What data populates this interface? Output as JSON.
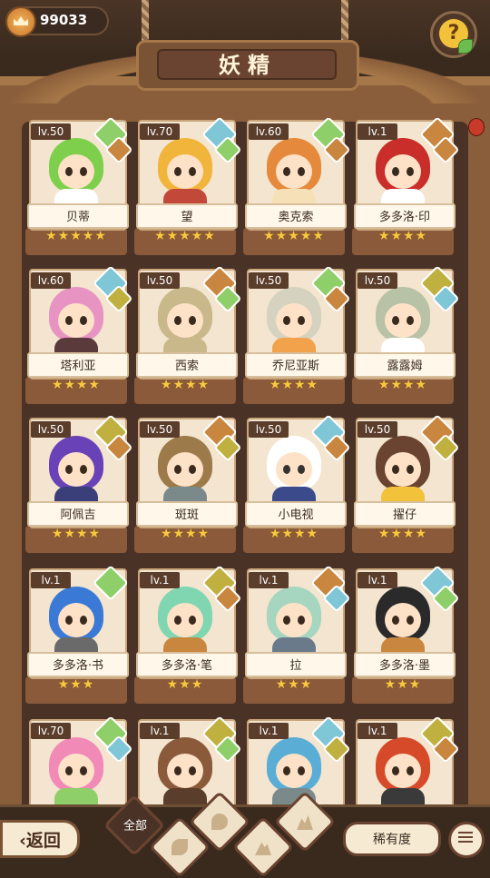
{
  "currency": {
    "amount": "99033",
    "icon": "crown-coin-icon"
  },
  "title": "妖精",
  "help_icon": "question-mark-icon",
  "cards": [
    {
      "level": "lv.50",
      "name": "贝蒂",
      "stars": "★★★★★",
      "hair": "#7ecf4c",
      "outfit": "#fff",
      "gem1": "#8fcf6a",
      "gem2": "#c9863f"
    },
    {
      "level": "lv.70",
      "name": "望",
      "stars": "★★★★★",
      "hair": "#f2b53c",
      "outfit": "#c2483a",
      "gem1": "#7fc6d6",
      "gem2": "#8fcf6a"
    },
    {
      "level": "lv.60",
      "name": "奥克索",
      "stars": "★★★★★",
      "hair": "#e58a3c",
      "outfit": "#f5e0b8",
      "gem1": "#8fcf6a",
      "gem2": "#c9863f"
    },
    {
      "level": "lv.1",
      "name": "多多洛·印",
      "stars": "★★★★",
      "hair": "#c92e2a",
      "outfit": "#fff",
      "gem1": "#c9863f",
      "gem2": "#c9863f"
    },
    {
      "level": "lv.60",
      "name": "塔利亚",
      "stars": "★★★★",
      "hair": "#e894c3",
      "outfit": "#5a3a3a",
      "gem1": "#7fc6d6",
      "gem2": "#c0b040"
    },
    {
      "level": "lv.50",
      "name": "西索",
      "stars": "★★★★",
      "hair": "#c9b98a",
      "outfit": "#c9b98a",
      "gem1": "#c9863f",
      "gem2": "#8fcf6a"
    },
    {
      "level": "lv.50",
      "name": "乔尼亚斯",
      "stars": "★★★★",
      "hair": "#d6d2c0",
      "outfit": "#f2a24a",
      "gem1": "#8fcf6a",
      "gem2": "#c9863f"
    },
    {
      "level": "lv.50",
      "name": "露露姆",
      "stars": "★★★★",
      "hair": "#b8c2a6",
      "outfit": "#fff",
      "gem1": "#c0b040",
      "gem2": "#7fc6d6"
    },
    {
      "level": "lv.50",
      "name": "阿佩吉",
      "stars": "★★★★",
      "hair": "#6a42b8",
      "outfit": "#3a3f7a",
      "gem1": "#c0b040",
      "gem2": "#c9863f"
    },
    {
      "level": "lv.50",
      "name": "斑斑",
      "stars": "★★★★",
      "hair": "#9c7a4a",
      "outfit": "#7a8a8a",
      "gem1": "#c9863f",
      "gem2": "#c0b040"
    },
    {
      "level": "lv.50",
      "name": "小电视",
      "stars": "★★★★",
      "hair": "#fff",
      "outfit": "#3a4a8a",
      "gem1": "#7fc6d6",
      "gem2": "#c9863f"
    },
    {
      "level": "lv.50",
      "name": "擢仔",
      "stars": "★★★★",
      "hair": "#6a4430",
      "outfit": "#f2c23b",
      "gem1": "#c9863f",
      "gem2": "#c0b040"
    },
    {
      "level": "lv.1",
      "name": "多多洛·书",
      "stars": "★★★",
      "hair": "#3a7ad6",
      "outfit": "#6a6a6a",
      "gem1": "#8fcf6a",
      "gem2": ""
    },
    {
      "level": "lv.1",
      "name": "多多洛·笔",
      "stars": "★★★",
      "hair": "#7fd6b0",
      "outfit": "#c9863f",
      "gem1": "#c0b040",
      "gem2": "#c9863f"
    },
    {
      "level": "lv.1",
      "name": "拉",
      "stars": "★★★",
      "hair": "#a6d6c0",
      "outfit": "#6a7a8a",
      "gem1": "#c9863f",
      "gem2": "#7fc6d6"
    },
    {
      "level": "lv.1",
      "name": "多多洛·墨",
      "stars": "★★★",
      "hair": "#2a2a2a",
      "outfit": "#c9863f",
      "gem1": "#7fc6d6",
      "gem2": "#8fcf6a"
    },
    {
      "level": "lv.70",
      "name": "",
      "stars": "",
      "hair": "#f28ab8",
      "outfit": "#8fcf6a",
      "gem1": "#8fcf6a",
      "gem2": "#7fc6d6"
    },
    {
      "level": "lv.1",
      "name": "",
      "stars": "",
      "hair": "#8a5a3a",
      "outfit": "#5a3d2b",
      "gem1": "#c0b040",
      "gem2": "#8fcf6a"
    },
    {
      "level": "lv.1",
      "name": "",
      "stars": "",
      "hair": "#5aaed6",
      "outfit": "#7a8a8a",
      "gem1": "#7fc6d6",
      "gem2": "#c0b040"
    },
    {
      "level": "lv.1",
      "name": "",
      "stars": "",
      "hair": "#d64a2a",
      "outfit": "#3a3a3a",
      "gem1": "#c0b040",
      "gem2": "#c9863f"
    }
  ],
  "bottom": {
    "back_label": "返回",
    "filter_all_label": "全部",
    "rarity_label": "稀有度",
    "sort_icon": "sort-list-icon"
  }
}
